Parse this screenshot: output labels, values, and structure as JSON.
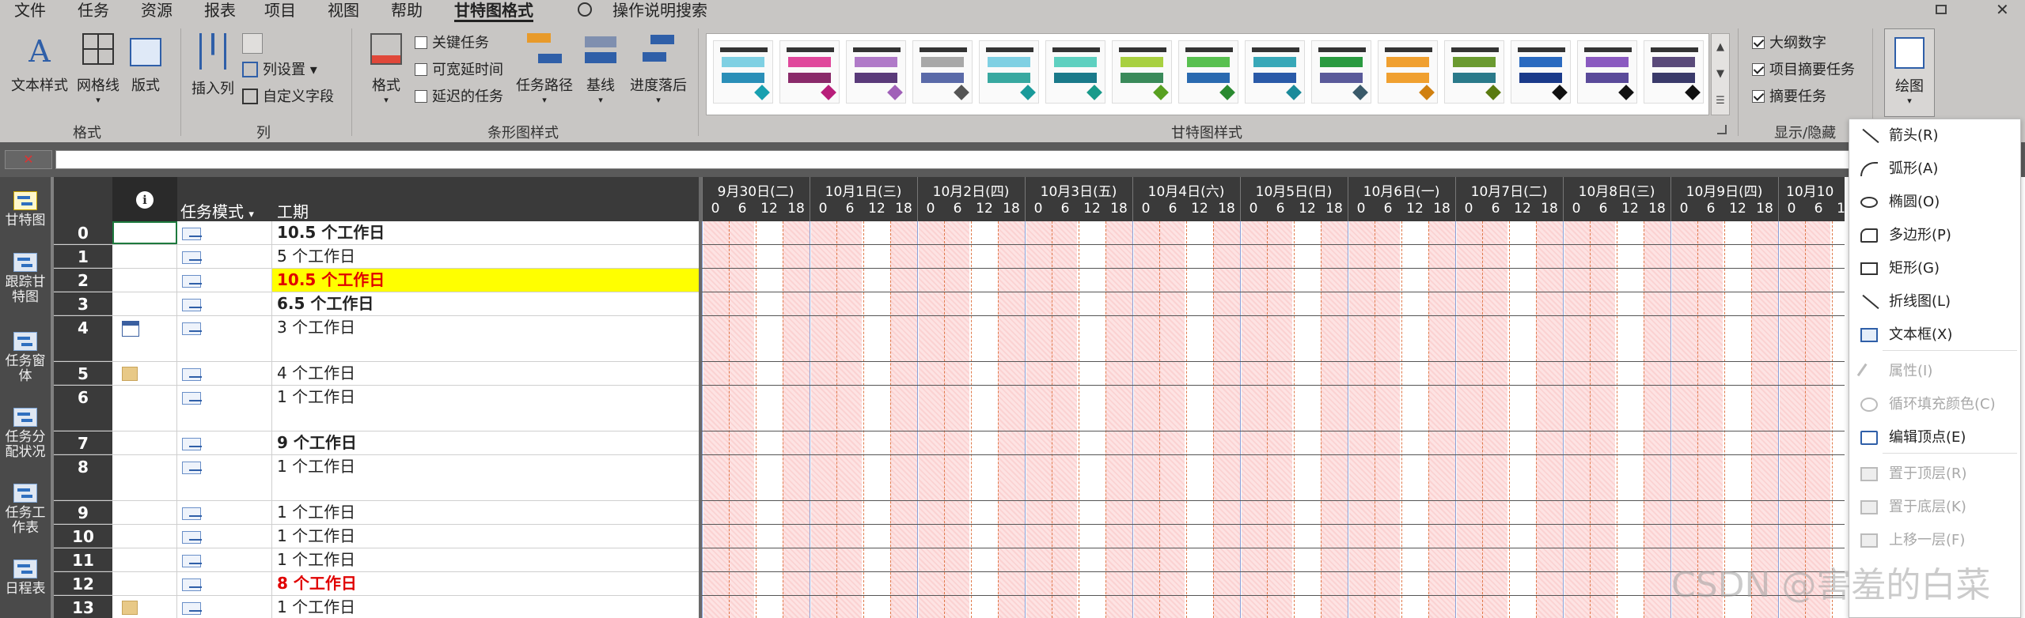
{
  "menu": {
    "tabs": [
      "文件",
      "任务",
      "资源",
      "报表",
      "项目",
      "视图",
      "帮助",
      "甘特图格式"
    ],
    "active_tab": "甘特图格式",
    "search": "操作说明搜索"
  },
  "ribbon": {
    "format_group": {
      "label": "格式",
      "text_styles": "文本样式",
      "gridlines": "网格线",
      "layout": "版式"
    },
    "columns_group": {
      "label": "列",
      "insert_column": "插入列",
      "column_settings": "列设置",
      "custom_fields": "自定义字段"
    },
    "bar_styles_group": {
      "label": "条形图样式",
      "format": "格式",
      "critical_tasks": "关键任务",
      "slack": "可宽延时间",
      "late_tasks": "延迟的任务",
      "task_path": "任务路径",
      "baseline": "基线",
      "slippage": "进度落后"
    },
    "gantt_styles_group": {
      "label": "甘特图样式",
      "styles": [
        {
          "a": "#7fd0e3",
          "b": "#2a8fb8",
          "d": "#18a0b0"
        },
        {
          "a": "#e0489c",
          "b": "#8a2a6a",
          "d": "#b81e7a"
        },
        {
          "a": "#b07ac8",
          "b": "#5a3a7a",
          "d": "#a060b8"
        },
        {
          "a": "#a8a8a8",
          "b": "#5a6aa8",
          "d": "#555555"
        },
        {
          "a": "#7fd0e3",
          "b": "#38a8a0",
          "d": "#1a9a9a"
        },
        {
          "a": "#5ed0c0",
          "b": "#1a7a8a",
          "d": "#189a8a"
        },
        {
          "a": "#a8d040",
          "b": "#3a8a5a",
          "d": "#58a020"
        },
        {
          "a": "#58c050",
          "b": "#2a6ab0",
          "d": "#2a8a30"
        },
        {
          "a": "#38a8b8",
          "b": "#2a5aa8",
          "d": "#1a8a9a"
        },
        {
          "a": "#2a9a40",
          "b": "#5a5a9a",
          "d": "#3a5a6a"
        },
        {
          "a": "#f0a030",
          "b": "#f0a030",
          "d": "#d08010"
        },
        {
          "a": "#6a9a30",
          "b": "#2a7a8a",
          "d": "#5a7a10"
        },
        {
          "a": "#2a6ac0",
          "b": "#1a3a8a",
          "d": "#111111"
        },
        {
          "a": "#8a5ac0",
          "b": "#5a4a9a",
          "d": "#111111"
        },
        {
          "a": "#5a4a7a",
          "b": "#3a3a6a",
          "d": "#111111"
        }
      ]
    },
    "show_hide_group": {
      "label": "显示/隐藏",
      "outline_number": "大纲数字",
      "project_summary": "项目摘要任务",
      "summary_tasks": "摘要任务"
    },
    "drawing": "绘图"
  },
  "views": [
    "甘特图",
    "跟踪甘特图",
    "任务窗体",
    "任务分配状况",
    "任务工作表",
    "日程表"
  ],
  "views_display": [
    "甘特图",
    "跟踪甘\n特图",
    "任务窗\n体",
    "任务分\n配状况",
    "任务工\n作表",
    "日程表"
  ],
  "table": {
    "columns": {
      "info": "ℹ",
      "mode": "任务模式",
      "duration": "工期"
    },
    "rows": [
      {
        "id": "0",
        "duration": "10.5 个工作日",
        "style": "bold"
      },
      {
        "id": "1",
        "duration": "5 个工作日",
        "style": "normal"
      },
      {
        "id": "2",
        "duration": "10.5 个工作日",
        "style": "highlight"
      },
      {
        "id": "3",
        "duration": "6.5 个工作日",
        "style": "bold"
      },
      {
        "id": "4",
        "duration": "3 个工作日",
        "style": "normal",
        "indicator": "calendar"
      },
      {
        "id": "5",
        "duration": "4 个工作日",
        "style": "normal",
        "indicator": "note"
      },
      {
        "id": "6",
        "duration": "1 个工作日",
        "style": "normal"
      },
      {
        "id": "7",
        "duration": "9 个工作日",
        "style": "bold"
      },
      {
        "id": "8",
        "duration": "1 个工作日",
        "style": "normal"
      },
      {
        "id": "9",
        "duration": "1 个工作日",
        "style": "normal"
      },
      {
        "id": "10",
        "duration": "1 个工作日",
        "style": "normal"
      },
      {
        "id": "11",
        "duration": "1 个工作日",
        "style": "normal"
      },
      {
        "id": "12",
        "duration": "8 个工作日",
        "style": "red"
      },
      {
        "id": "13",
        "duration": "1 个工作日",
        "style": "normal",
        "indicator": "note"
      }
    ]
  },
  "timescale": {
    "days": [
      "9月30日(二)",
      "10月1日(三)",
      "10月2日(四)",
      "10月3日(五)",
      "10月4日(六)",
      "10月5日(日)",
      "10月6日(一)",
      "10月7日(二)",
      "10月8日(三)",
      "10月9日(四)",
      "10月10"
    ],
    "hours": [
      "0",
      "6",
      "12",
      "18"
    ]
  },
  "draw_menu": [
    {
      "label": "箭头(R)",
      "icon": "arrow-line-icon",
      "enabled": true
    },
    {
      "label": "弧形(A)",
      "icon": "arc-icon",
      "enabled": true
    },
    {
      "label": "椭圆(O)",
      "icon": "ellipse-icon",
      "enabled": true
    },
    {
      "label": "多边形(P)",
      "icon": "polygon-icon",
      "enabled": true
    },
    {
      "label": "矩形(G)",
      "icon": "rectangle-icon",
      "enabled": true
    },
    {
      "label": "折线图(L)",
      "icon": "line-icon",
      "enabled": true
    },
    {
      "label": "文本框(X)",
      "icon": "textbox-icon",
      "enabled": true
    },
    {
      "label": "属性(I)",
      "icon": "properties-icon",
      "enabled": false
    },
    {
      "label": "循环填充颜色(C)",
      "icon": "cycle-fill-icon",
      "enabled": false
    },
    {
      "label": "编辑顶点(E)",
      "icon": "edit-points-icon",
      "enabled": true
    },
    {
      "label": "置于顶层(R)",
      "icon": "bring-front-icon",
      "enabled": false
    },
    {
      "label": "置于底层(K)",
      "icon": "send-back-icon",
      "enabled": false
    },
    {
      "label": "上移一层(F)",
      "icon": "bring-forward-icon",
      "enabled": false
    }
  ],
  "watermark": "CSDN @害羞的白菜"
}
